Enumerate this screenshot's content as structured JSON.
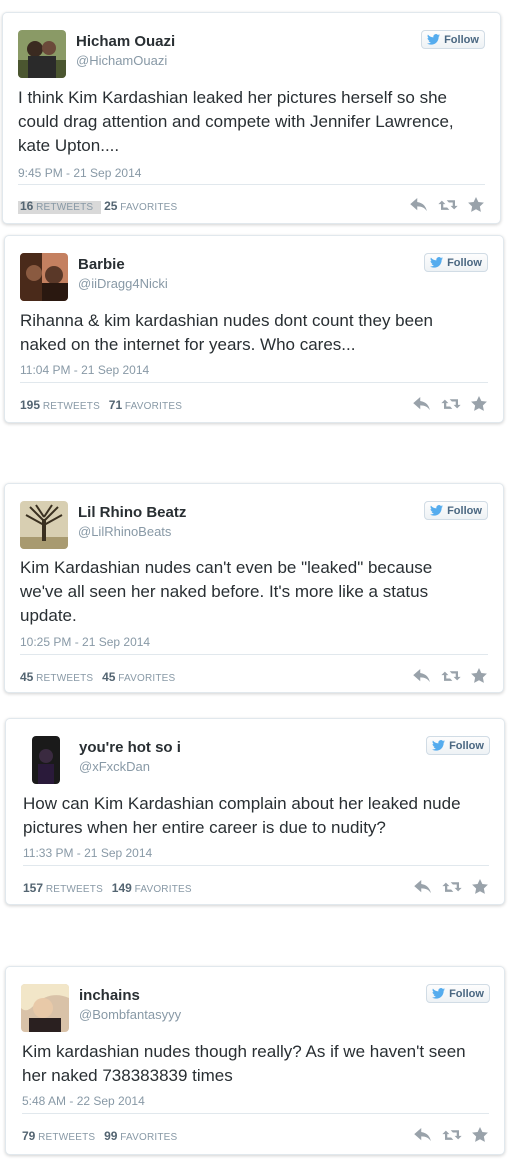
{
  "follow_label": "Follow",
  "tweets": [
    {
      "name": "Hicham Ouazi",
      "handle": "@HichamOuazi",
      "lines": [
        "I think Kim Kardashian leaked her pictures herself so she",
        "could drag attention and compete with Jennifer Lawrence,",
        "kate Upton...."
      ],
      "time": "9:45 PM - 21 Sep 2014",
      "retweets": "16",
      "retweets_label": "RETWEETS",
      "favorites": "25",
      "favorites_label": "FAVORITES"
    },
    {
      "name": "Barbie",
      "handle": "@iiDragg4Nicki",
      "lines": [
        "Rihanna & kim kardashian nudes dont count they been",
        "naked on the internet for years. Who cares..."
      ],
      "time": "11:04 PM - 21 Sep 2014",
      "retweets": "195",
      "retweets_label": "RETWEETS",
      "favorites": "71",
      "favorites_label": "FAVORITES"
    },
    {
      "name": "Lil Rhino Beatz",
      "handle": "@LilRhinoBeats",
      "lines": [
        "Kim Kardashian nudes can't even be \"leaked\" because",
        "we've all seen her naked before. It's more like a status",
        "update."
      ],
      "time": "10:25 PM - 21 Sep 2014",
      "retweets": "45",
      "retweets_label": "RETWEETS",
      "favorites": "45",
      "favorites_label": "FAVORITES"
    },
    {
      "name": "you're hot so i",
      "handle": "@xFxckDan",
      "lines": [
        "How can Kim Kardashian complain about her leaked nude",
        "pictures when her entire career is due to nudity?"
      ],
      "time": "11:33 PM - 21 Sep 2014",
      "retweets": "157",
      "retweets_label": "RETWEETS",
      "favorites": "149",
      "favorites_label": "FAVORITES"
    },
    {
      "name": "inchains",
      "handle": "@Bombfantasyyy",
      "lines": [
        "Kim kardashian nudes though really? As if we haven't seen",
        "her naked 738383839 times"
      ],
      "time": "5:48 AM - 22 Sep 2014",
      "retweets": "79",
      "retweets_label": "RETWEETS",
      "favorites": "99",
      "favorites_label": "FAVORITES"
    }
  ]
}
